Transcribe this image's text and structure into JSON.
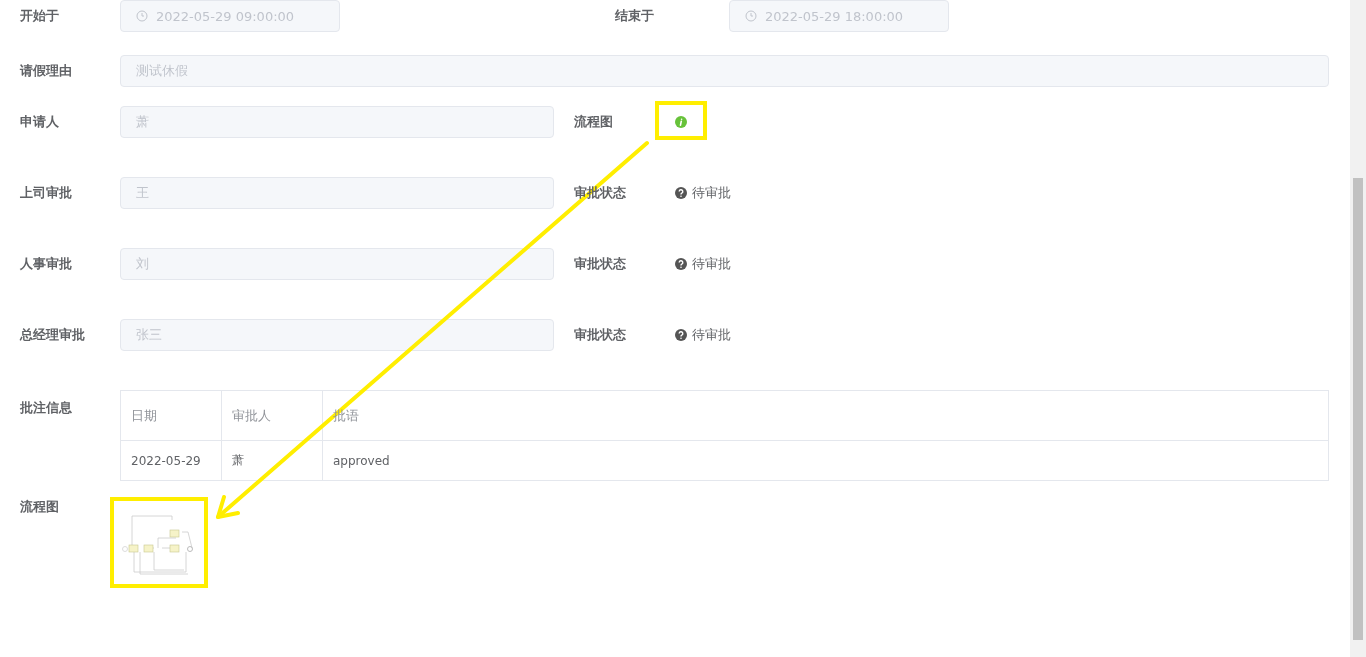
{
  "time_range": {
    "start": {
      "label": "开始于",
      "value": "2022-05-29 09:00:00"
    },
    "end": {
      "label": "结束于",
      "value": "2022-05-29 18:00:00"
    }
  },
  "reason": {
    "label": "请假理由",
    "value": "测试休假"
  },
  "applicant": {
    "label": "申请人",
    "value": "萧"
  },
  "flowchart_link": {
    "label": "流程图"
  },
  "approvals": [
    {
      "label": "上司审批",
      "value": "王",
      "status_label": "审批状态",
      "status": "待审批"
    },
    {
      "label": "人事审批",
      "value": "刘",
      "status_label": "审批状态",
      "status": "待审批"
    },
    {
      "label": "总经理审批",
      "value": "张三",
      "status_label": "审批状态",
      "status": "待审批"
    }
  ],
  "comments": {
    "label": "批注信息",
    "columns": [
      "日期",
      "审批人",
      "批语"
    ],
    "rows": [
      [
        "2022-05-29",
        "萧",
        "approved"
      ]
    ]
  },
  "flowchart": {
    "label": "流程图"
  }
}
